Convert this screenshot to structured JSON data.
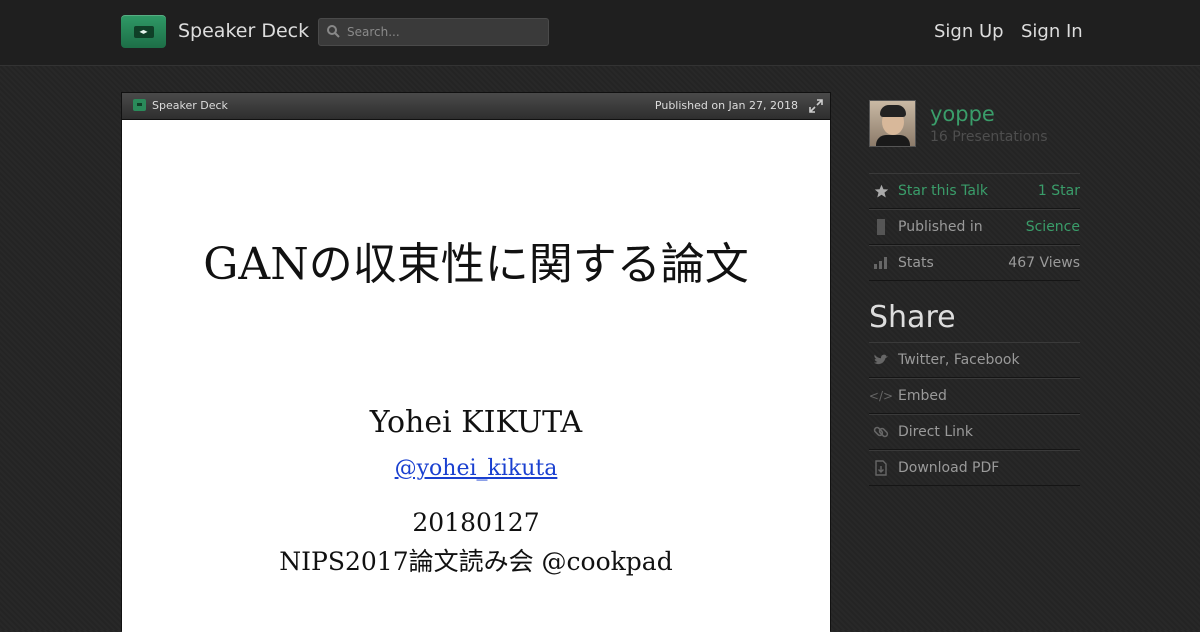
{
  "header": {
    "logo_text": "Speaker Deck",
    "search_placeholder": "Search...",
    "signup_label": "Sign Up",
    "signin_label": "Sign In"
  },
  "viewer": {
    "brand": "Speaker Deck",
    "published": "Published on Jan 27, 2018",
    "slide": {
      "title": "GANの収束性に関する論文",
      "author": "Yohei KIKUTA",
      "handle": "@yohei_kikuta",
      "date": "20180127",
      "event": "NIPS2017論文読み会 @cookpad"
    }
  },
  "sidebar": {
    "username": "yoppe",
    "presentations": "16 Presentations",
    "star_label": "Star this Talk",
    "star_count": "1 Star",
    "published_label": "Published in",
    "published_value": "Science",
    "stats_label": "Stats",
    "stats_value": "467 Views",
    "share_title": "Share",
    "share_items": [
      "Twitter, Facebook",
      "Embed",
      "Direct Link",
      "Download PDF"
    ]
  },
  "colors": {
    "accent_green": "#3a9d6a",
    "background": "#252525"
  }
}
